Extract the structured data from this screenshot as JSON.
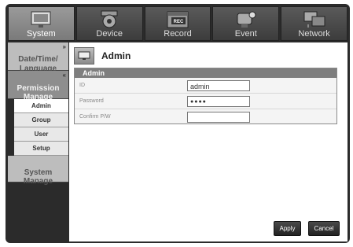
{
  "tabs": [
    {
      "label": "System",
      "icon": "monitor-icon"
    },
    {
      "label": "Device",
      "icon": "camera-icon"
    },
    {
      "label": "Record",
      "icon": "record-calendar-icon",
      "badge": "REC"
    },
    {
      "label": "Event",
      "icon": "event-camera-icon"
    },
    {
      "label": "Network",
      "icon": "network-icon"
    }
  ],
  "sidebar": {
    "date_time_language": "Date/Time/\nLanguage",
    "permission_manage": "Permission\nManage",
    "sub_items": [
      "Admin",
      "Group",
      "User",
      "Setup"
    ],
    "system_manage": "System\nManage"
  },
  "main": {
    "title": "Admin",
    "panel_title": "Admin",
    "fields": [
      {
        "label": "ID",
        "value": "admin"
      },
      {
        "label": "Password",
        "value": "●●●●"
      },
      {
        "label": "Confirm P/W",
        "value": ""
      }
    ],
    "apply_label": "Apply",
    "cancel_label": "Cancel"
  },
  "colors": {
    "active_tab": "#8a8a8a",
    "frame": "#2b2b2b"
  }
}
